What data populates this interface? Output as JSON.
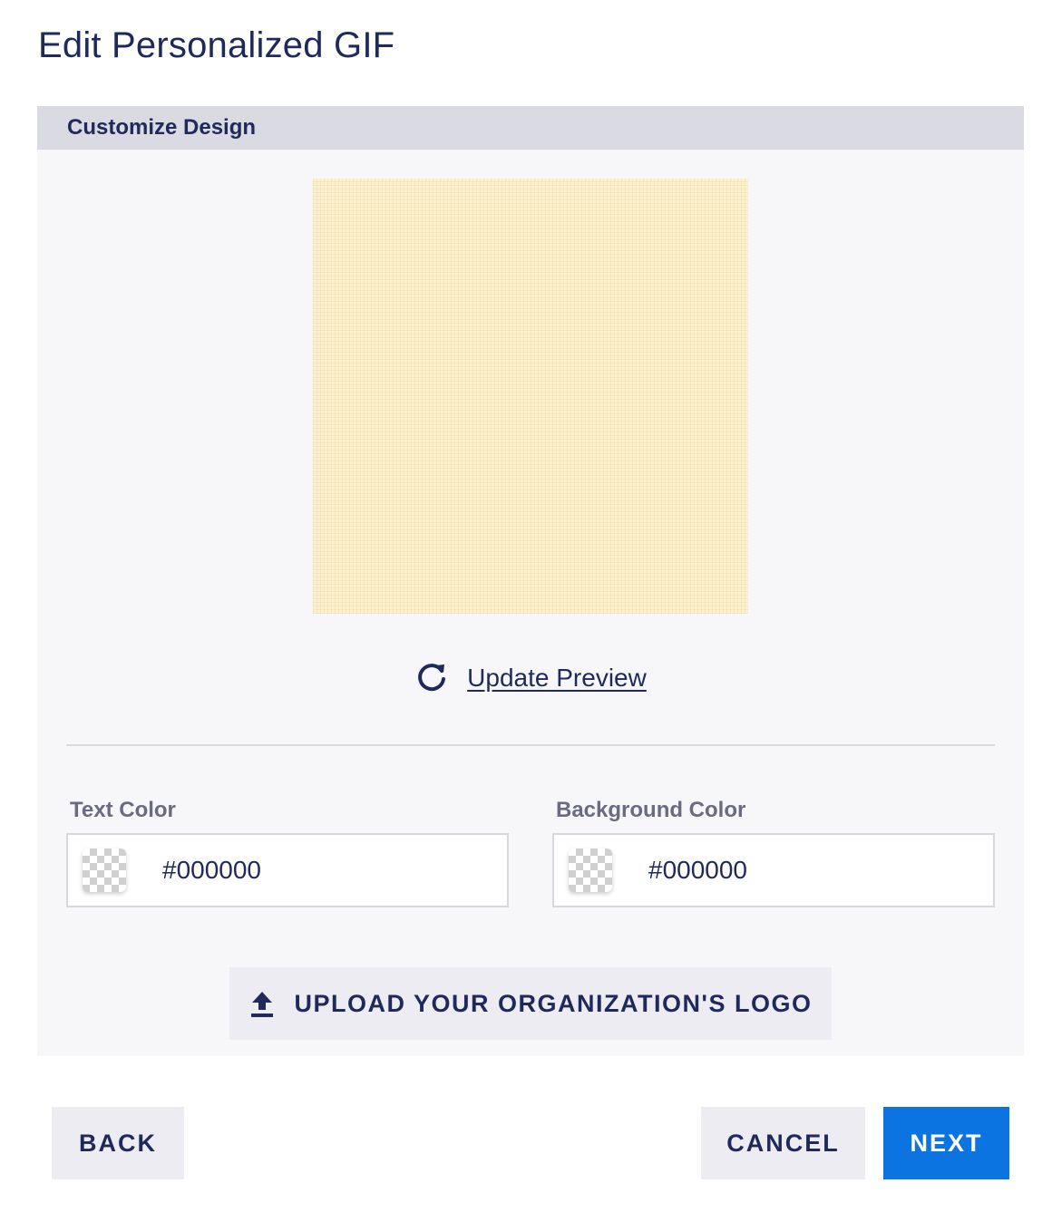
{
  "page": {
    "title": "Edit Personalized GIF"
  },
  "panel": {
    "header": "Customize Design",
    "preview": {
      "update_label": "Update Preview",
      "update_icon": "refresh-icon"
    },
    "text_color": {
      "label": "Text Color",
      "value": "#000000"
    },
    "background_color": {
      "label": "Background Color",
      "value": "#000000"
    },
    "upload": {
      "label": "UPLOAD YOUR ORGANIZATION'S LOGO",
      "icon": "upload-icon"
    }
  },
  "footer": {
    "back_label": "BACK",
    "cancel_label": "CANCEL",
    "next_label": "NEXT"
  },
  "colors": {
    "primary": "#0b74e0",
    "text": "#1f2a5a",
    "panel_header": "#dadae3",
    "panel_bg": "#f7f7fa",
    "preview_bg": "#fdf1cf"
  }
}
